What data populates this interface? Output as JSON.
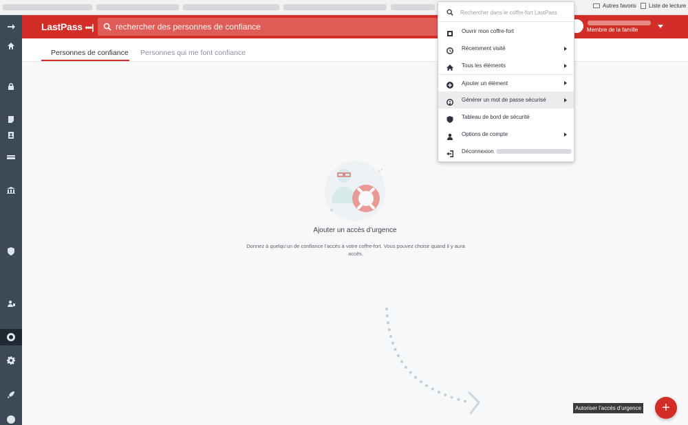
{
  "browser": {
    "bookmark_other": "Autres favoris",
    "bookmark_reading_list": "Liste de lecture"
  },
  "header": {
    "logo": "LastPass",
    "logo_dots": "•••|",
    "search_placeholder": "rechercher des personnes de confiance",
    "user_role": "Membre de la famille"
  },
  "sidebar": {
    "icons": [
      "arrow-right-icon",
      "home-icon",
      "lock-icon",
      "note-icon",
      "address-icon",
      "card-icon",
      "bank-icon",
      "security-shield-icon",
      "sharing-icon",
      "emergency-lifebuoy-icon",
      "gear-icon",
      "rocket-icon",
      "help-icon"
    ],
    "active": "emergency-lifebuoy-icon"
  },
  "tabs": [
    {
      "label": "Personnes de confiance",
      "active": true
    },
    {
      "label": "Personnes qui me font confiance",
      "active": false
    }
  ],
  "empty_state": {
    "title": "Ajouter un accès d’urgence",
    "description": "Donnez à quelqu’un de confiance l’accès à votre coffre-fort. Vous pouvez choisir quand il y aura accès."
  },
  "fab": {
    "label": "Autoriser l’accès d’urgence",
    "symbol": "+"
  },
  "menu": {
    "search_placeholder": "Rechercher dans le coffre-fort LastPass",
    "items": [
      {
        "label": "Ouvrir mon coffre-fort",
        "icon": "vault-icon",
        "submenu": false
      },
      {
        "label": "Récemment visité",
        "icon": "clock-icon",
        "submenu": true
      },
      {
        "label": "Tous les éléments",
        "icon": "home-icon",
        "submenu": true
      },
      {
        "label": "Ajouter un élément",
        "icon": "plus-circle-icon",
        "submenu": true
      },
      {
        "label": "Générer un mot de passe sécurisé",
        "icon": "generate-icon",
        "submenu": true,
        "highlight": true
      },
      {
        "label": "Tableau de bord de sécurité",
        "icon": "shield-icon",
        "submenu": false
      },
      {
        "label": "Options de compte",
        "icon": "user-icon",
        "submenu": true
      },
      {
        "label": "Déconnexion",
        "icon": "logout-icon",
        "submenu": false
      }
    ]
  },
  "colors": {
    "brand_red": "#d32d27",
    "sidebar": "#3d4a56",
    "sidebar_active": "#1f2931"
  }
}
